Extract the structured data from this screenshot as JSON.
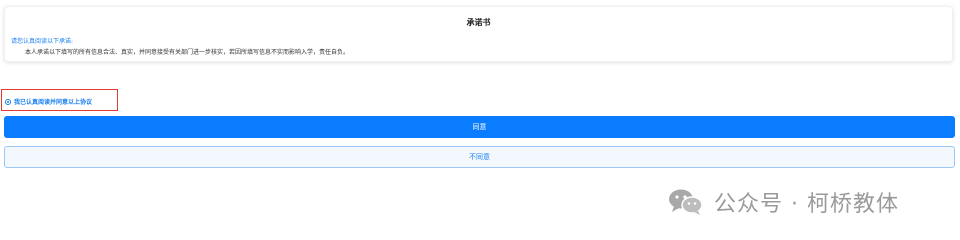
{
  "card": {
    "title": "承诺书",
    "prompt": "请您认真阅读以下承诺:",
    "body": "本人承诺以下填写的所有信息合法、真实，并同意接受有关部门进一步核实，若因所填写信息不实而影响入学，责任自负。"
  },
  "agreement": {
    "checkbox_label": "我已认真阅读并同意以上协议",
    "checked": true
  },
  "buttons": {
    "agree_label": "同意",
    "disagree_label": "不同意"
  },
  "watermark": {
    "icon": "wechat-icon",
    "text": "公众号 · 柯桥教体"
  },
  "colors": {
    "accent": "#0a7cff",
    "highlight_border": "#e53935",
    "watermark": "#9a9a9a"
  }
}
